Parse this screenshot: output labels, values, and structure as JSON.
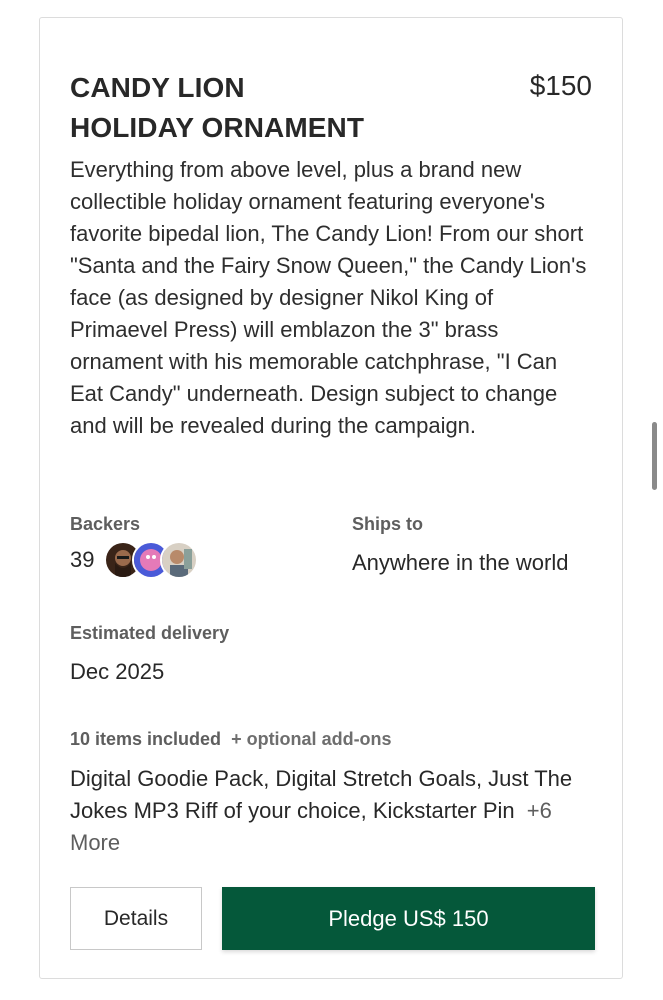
{
  "reward": {
    "title": "CANDY LION\nHOLIDAY ORNAMENT",
    "price": "$150",
    "description": "Everything from above level, plus a brand new collectible holiday ornament featuring everyone's favorite bipedal lion, The Candy Lion! From our short \"Santa and the Fairy Snow Queen,\" the Candy Lion's face (as designed by designer Nikol King of Primaevel Press) will emblazon the 3\" brass ornament with his memorable catchphrase, \"I Can Eat Candy\" underneath. Design subject to change and will be revealed during the campaign."
  },
  "backers": {
    "label": "Backers",
    "count": "39"
  },
  "ships_to": {
    "label": "Ships to",
    "value": "Anywhere in the world"
  },
  "delivery": {
    "label": "Estimated delivery",
    "value": "Dec 2025"
  },
  "items": {
    "label": "10 items included",
    "addons": "+ optional add-ons",
    "list": "Digital Goodie Pack, Digital Stretch Goals, Just The Jokes MP3 Riff of your choice, Kickstarter Pin",
    "more": "+6 More"
  },
  "buttons": {
    "details": "Details",
    "pledge": "Pledge US$ 150"
  },
  "colors": {
    "pledge_bg": "#05583a",
    "text": "#282828",
    "label": "#5e5e5e"
  }
}
